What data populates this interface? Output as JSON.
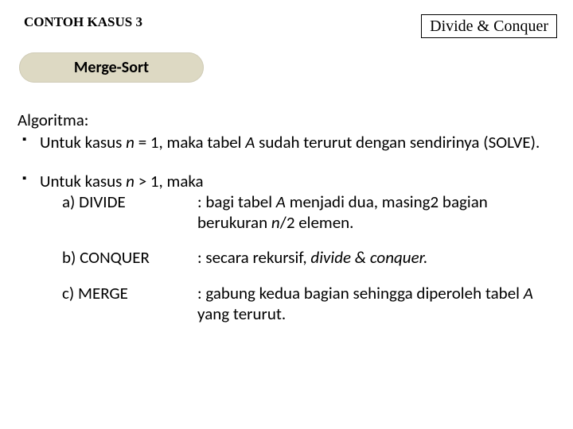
{
  "header": {
    "case_title": "CONTOH KASUS 3",
    "box_label": "Divide & Conquer"
  },
  "pill": {
    "label": "Merge-Sort"
  },
  "algo": {
    "label": "Algoritma:",
    "b1_pre": "Untuk kasus ",
    "b1_em": "n",
    "b1_mid": " = 1, maka tabel ",
    "b1_em2": "A",
    "b1_post": " sudah terurut dengan sendirinya (SOLVE).",
    "b2_pre": "Untuk kasus ",
    "b2_em": "n",
    "b2_post": " > 1, maka",
    "a_lab": "a)  DIVIDE",
    "a_desc_pre": ": bagi tabel ",
    "a_desc_em1": "A",
    "a_desc_mid": " menjadi dua, masing2 bagian berukuran ",
    "a_desc_em2": "n",
    "a_desc_post": "/2 elemen.",
    "b_lab": "b)   CONQUER",
    "b_desc_pre": ": secara rekursif, ",
    "b_desc_em": "divide & conquer.",
    "c_lab": "c)  MERGE",
    "c_desc_pre": ": gabung kedua bagian sehingga diperoleh tabel ",
    "c_desc_em": "A",
    "c_desc_post": " yang terurut."
  }
}
